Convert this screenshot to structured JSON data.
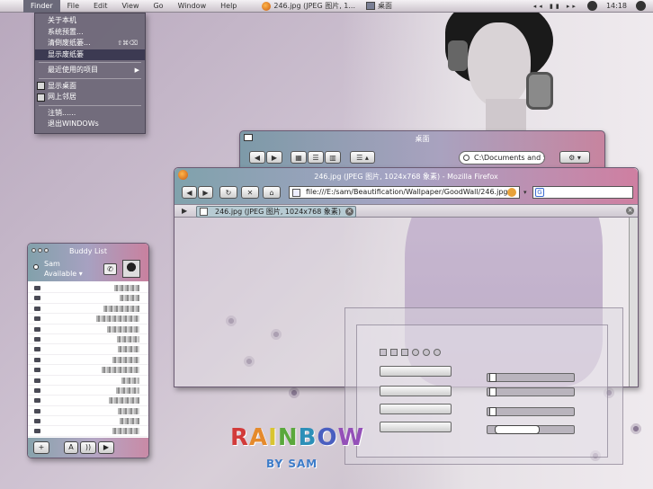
{
  "menubar": {
    "apple_glyph": "",
    "items": [
      "Finder",
      "File",
      "Edit",
      "View",
      "Go",
      "Window",
      "Help"
    ],
    "tasks": [
      {
        "label": "246.jpg (JPEG 图片, 1..."
      },
      {
        "label": "桌面"
      }
    ],
    "media_controls": "◂◂ ▮▮ ▸▸",
    "clock": "14:18"
  },
  "finder_menu": {
    "items": [
      {
        "label": "关于本机"
      },
      {
        "label": "系统预置..."
      },
      {
        "label": "清倒废纸篓...",
        "shortcut": "⇧⌘⌫"
      },
      {
        "label": "显示废纸篓",
        "selected": true
      },
      {
        "label": "最近使用的项目",
        "submenu": true
      },
      {
        "label": "显示桌面"
      },
      {
        "label": "网上邻居"
      },
      {
        "label": "注销......"
      },
      {
        "label": "退出WINDOWs"
      }
    ]
  },
  "finder_window": {
    "title": "桌面",
    "search_value": "C:\\Documents and Se"
  },
  "firefox": {
    "title": "246.jpg (JPEG 图片, 1024x768 象素) - Mozilla Firefox",
    "url": "file:///E:/sam/Beautification/Wallpaper/GoodWall/246.jpg",
    "search_engine_glyph": "G",
    "tab_label": "246.jpg (JPEG 图片, 1024x768 象素)"
  },
  "buddy_list": {
    "title": "Buddy List",
    "user_name": "Sam",
    "status": "Available ▾",
    "row_count": 15,
    "footer_buttons": [
      "+",
      "A",
      "))",
      "▶"
    ]
  },
  "logo": {
    "rainbow_letters": [
      "R",
      "A",
      "I",
      "N",
      "B",
      "O",
      "W"
    ],
    "byline": "BY SAM"
  }
}
